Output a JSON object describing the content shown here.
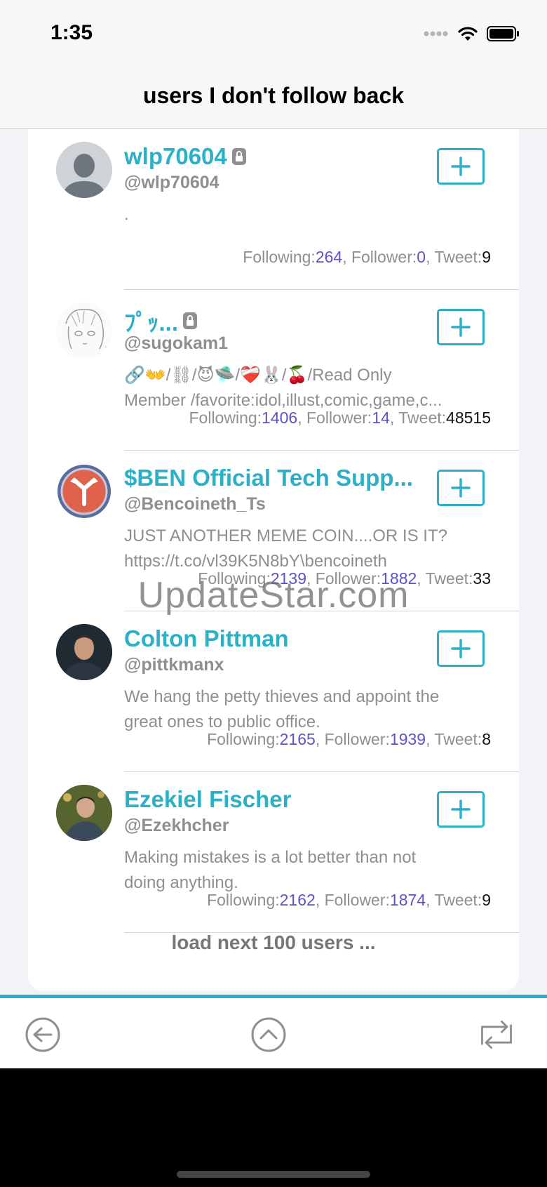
{
  "status_bar": {
    "time": "1:35"
  },
  "nav": {
    "title": "users I don't follow back"
  },
  "users": [
    {
      "name": "wlp70604",
      "handle": "@wlp70604",
      "locked": true,
      "bio_line1": ".",
      "bio_line2": "",
      "following_label": "Following:",
      "following": "264",
      "follower_label": ", Follower:",
      "follower": "0",
      "tweet_label": ", Tweet:",
      "tweet": "9"
    },
    {
      "name": "ﾌﾟｯ...",
      "handle": "@sugokam1",
      "locked": true,
      "bio_line1": "🔗👐/⛓/😈🛸/❤️‍🩹🐰/🍒/Read Only",
      "bio_line2": "Member /favorite:idol,illust,comic,game,c...",
      "following_label": "Following:",
      "following": "1406",
      "follower_label": ", Follower:",
      "follower": "14",
      "tweet_label": ", Tweet:",
      "tweet": "48515"
    },
    {
      "name": "$BEN Official Tech Supp...",
      "handle": "@Bencoineth_Ts",
      "locked": false,
      "bio_line1": "JUST ANOTHER MEME COIN....OR IS IT?",
      "bio_line2": "https://t.co/vl39K5N8bY\\bencoineth",
      "following_label": "Following:",
      "following": "2139",
      "follower_label": ", Follower:",
      "follower": "1882",
      "tweet_label": ", Tweet:",
      "tweet": "33"
    },
    {
      "name": "Colton Pittman",
      "handle": "@pittkmanx",
      "locked": false,
      "bio_line1": "We hang the petty thieves and appoint the",
      "bio_line2": "great ones to public office.",
      "following_label": "Following:",
      "following": "2165",
      "follower_label": ", Follower:",
      "follower": "1939",
      "tweet_label": ", Tweet:",
      "tweet": "8"
    },
    {
      "name": "Ezekiel Fischer",
      "handle": "@Ezekhcher",
      "locked": false,
      "bio_line1": "Making mistakes is a lot better than not",
      "bio_line2": "doing anything.",
      "following_label": "Following:",
      "following": "2162",
      "follower_label": ", Follower:",
      "follower": "1874",
      "tweet_label": ", Tweet:",
      "tweet": "9"
    }
  ],
  "load_more": "load next 100 users ...",
  "watermark": "UpdateStar.com",
  "colors": {
    "accent": "#2bb0c7",
    "stat_number": "#5b54c9",
    "secondary_text": "#8e8e93"
  },
  "icons": {
    "follow": "plus-square-icon",
    "lock": "lock-icon",
    "back": "circle-arrow-left-icon",
    "top": "circle-chevron-up-icon",
    "refresh": "repeat-icon"
  }
}
